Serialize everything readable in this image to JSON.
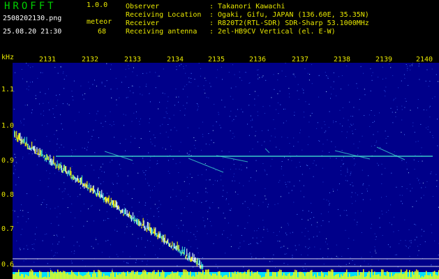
{
  "header": {
    "app_title": "HROFFT",
    "app_version": "1.0.0",
    "file_name": "2508202130.png",
    "datetime": "25.08.20 21:30",
    "meteor_label": "meteor",
    "meteor_count": "68",
    "info": [
      {
        "key": "Observer",
        "value": ": Takanori Kawachi"
      },
      {
        "key": "Receiving Location",
        "value": ": Ogaki, Gifu, JAPAN (136.60E, 35.35N)"
      },
      {
        "key": "Receiver",
        "value": ": R820T2(RTL-SDR) SDR-Sharp 53.1000MHz"
      },
      {
        "key": "Receiving antenna",
        "value": ": 2el-HB9CV Vertical (el. E-W)"
      }
    ]
  },
  "axes": {
    "unit_label": "kHz",
    "y_ticks": [
      "1.1",
      "1.0",
      "0.9",
      "0.8",
      "0.7",
      "0.6"
    ],
    "x_ticks": [
      "2131",
      "2132",
      "2133",
      "2134",
      "2135",
      "2136",
      "2137",
      "2138",
      "2139",
      "2140"
    ]
  },
  "colors": {
    "background_noise": "#00008a",
    "noise_speck": "#4a7cff",
    "carrier_line": "#40e0d0",
    "interference": "#ffff00",
    "interference_base": "#00e0ff",
    "text_yellow": "#e8e800",
    "title_green": "#00d000",
    "reference_line": "#ffffff"
  }
}
